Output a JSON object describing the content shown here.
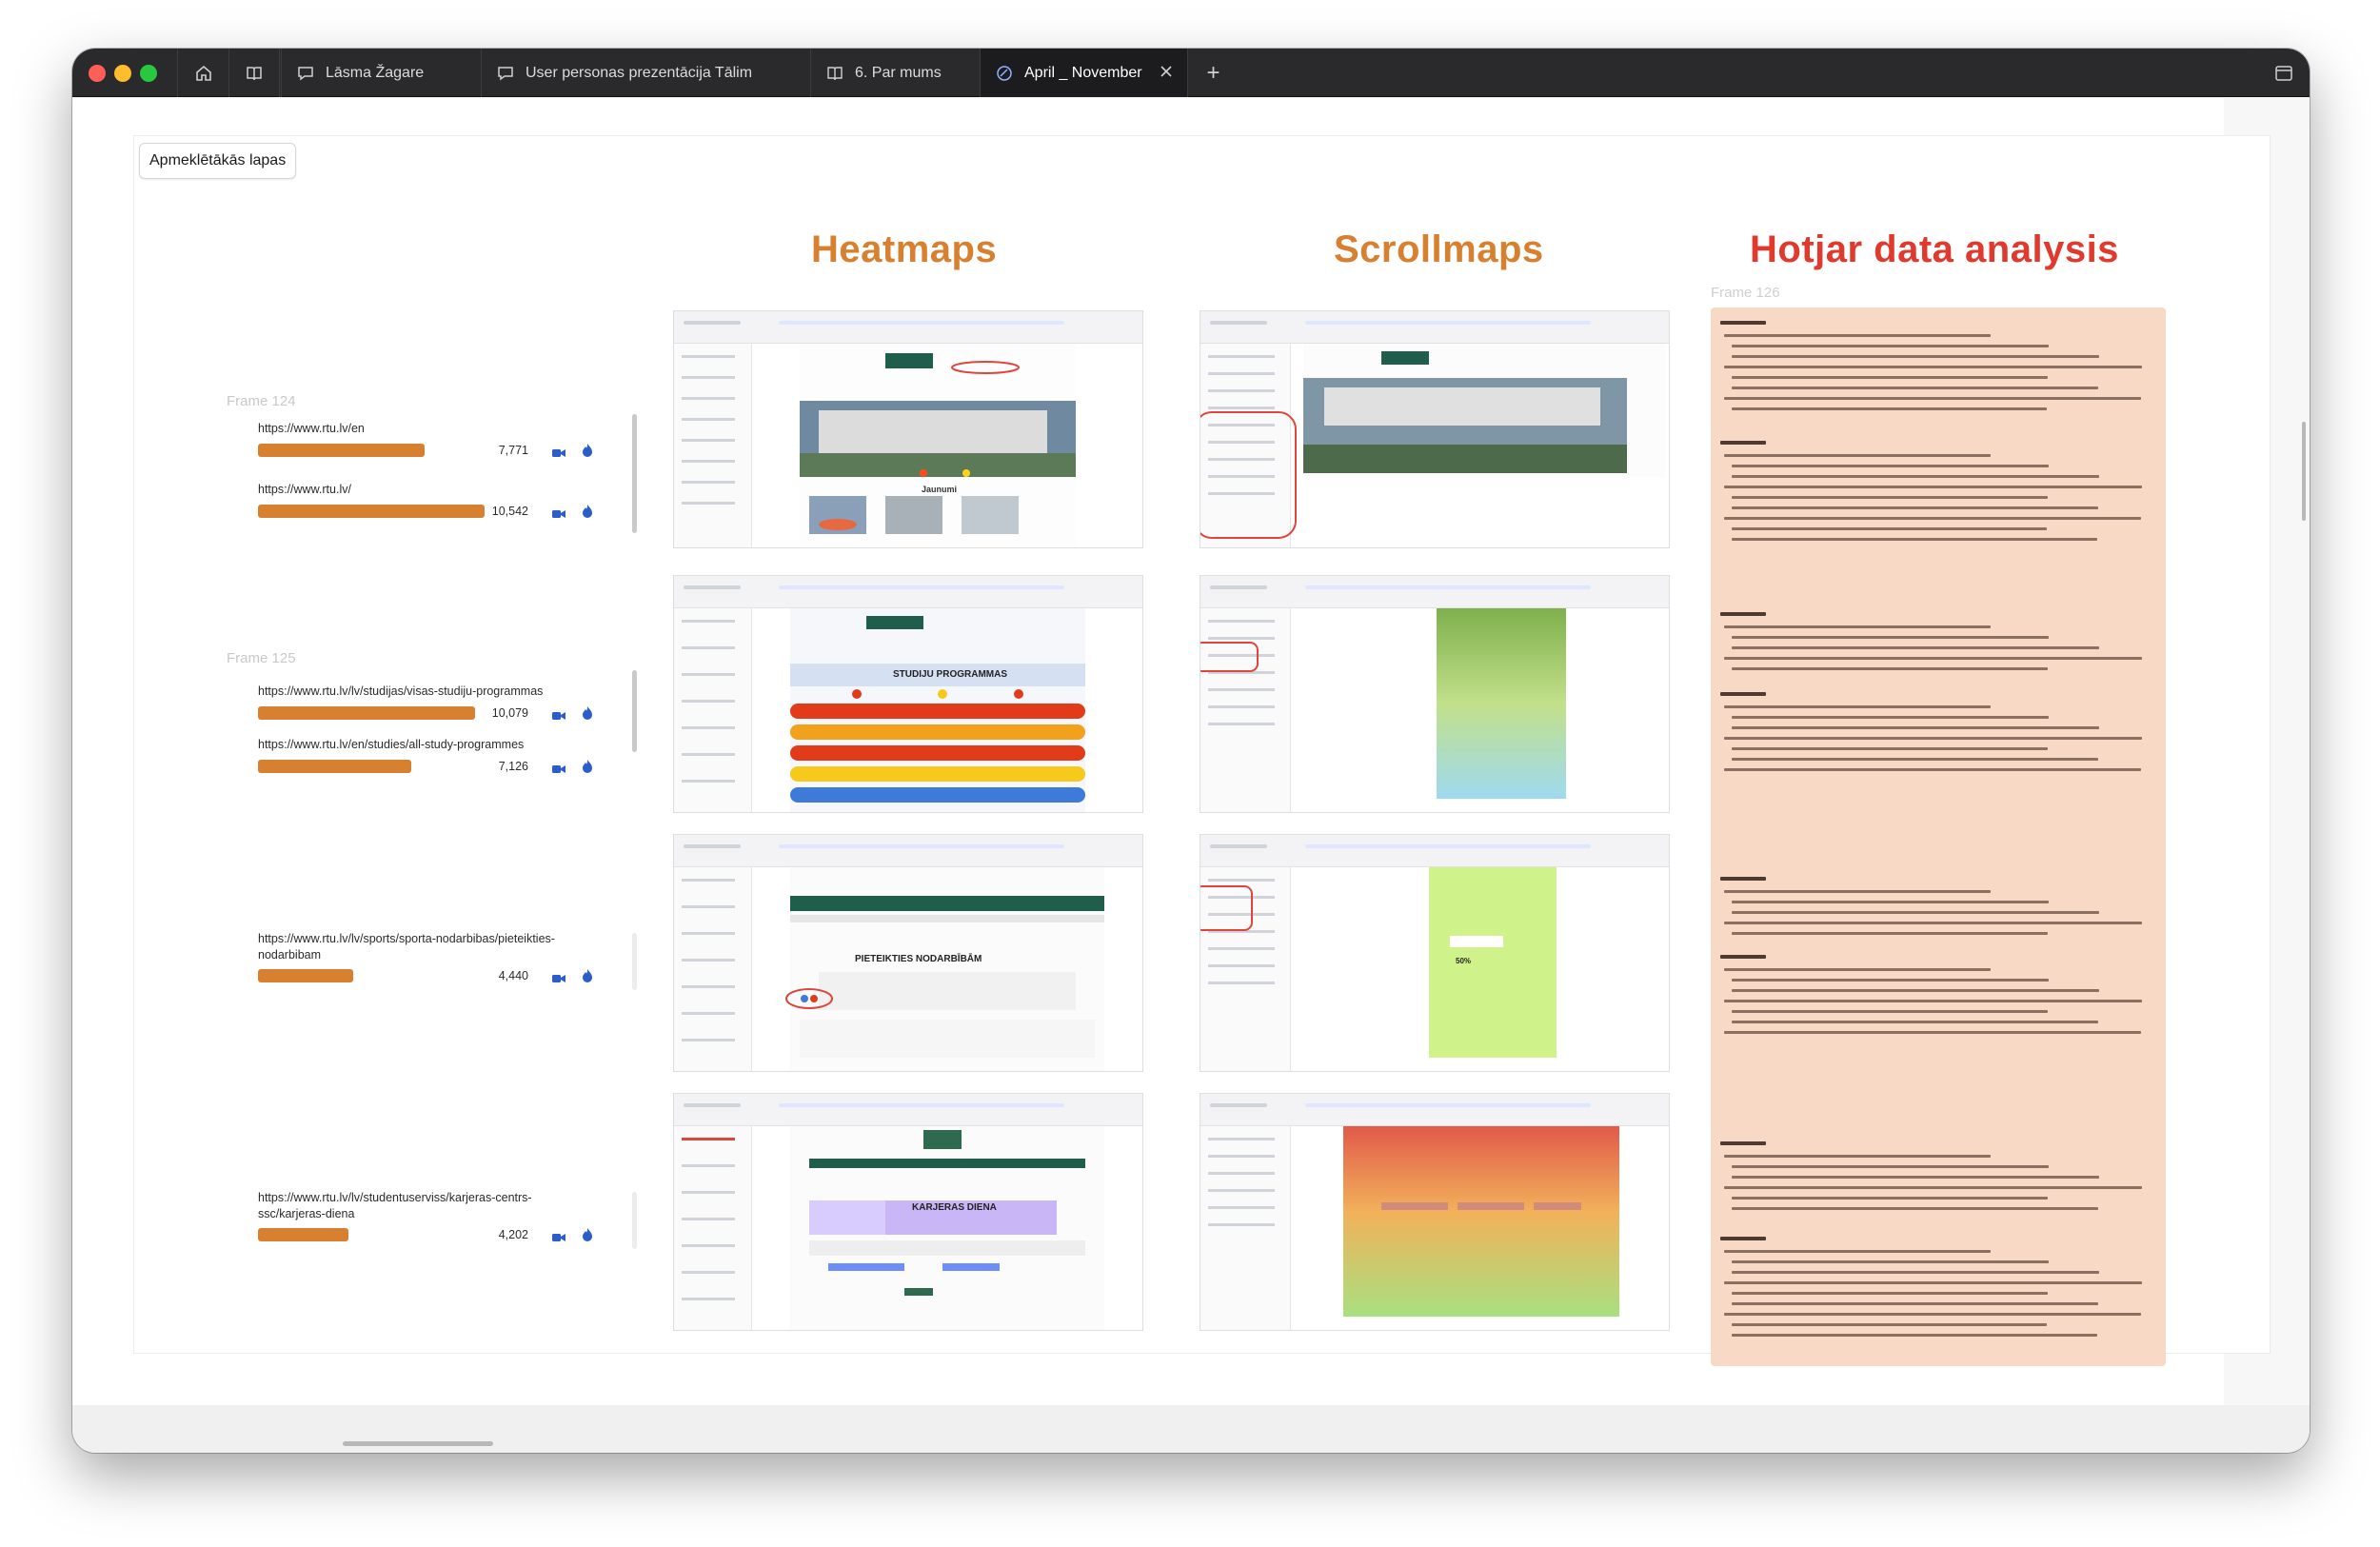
{
  "browser": {
    "tabs": [
      {
        "label": "Lāsma Žagare",
        "icon": "chat-icon"
      },
      {
        "label": "User personas prezentācija Tālim",
        "icon": "chat-icon"
      },
      {
        "label": "6. Par mums",
        "icon": "book-icon"
      },
      {
        "label": "April _ November",
        "icon": "design-icon",
        "active": true
      }
    ],
    "new_tab_label": "+"
  },
  "board": {
    "chip_label": "Apmeklētākās lapas",
    "headings": {
      "heatmaps": "Heatmaps",
      "scrollmaps": "Scrollmaps",
      "analysis": "Hotjar data analysis"
    },
    "heading_colors": {
      "heatmaps": "#d68030",
      "scrollmaps": "#d68030",
      "analysis": "#e03a2f"
    },
    "bar_color": "#d68030",
    "frames": [
      {
        "label": "Frame 124"
      },
      {
        "label": "Frame 125"
      },
      {
        "label": "Frame 126"
      }
    ],
    "pages": [
      {
        "url": "https://www.rtu.lv/en",
        "visits": "7,771",
        "visits_n": 7771
      },
      {
        "url": "https://www.rtu.lv/",
        "visits": "10,542",
        "visits_n": 10542
      },
      {
        "url": "https://www.rtu.lv/lv/studijas/visas-studiju-programmas",
        "visits": "10,079",
        "visits_n": 10079
      },
      {
        "url": "https://www.rtu.lv/en/studies/all-study-programmes",
        "visits": "7,126",
        "visits_n": 7126
      },
      {
        "url": "https://www.rtu.lv/lv/sports/sporta-nodarbibas/pieteikties-nodarbibam",
        "visits": "4,440",
        "visits_n": 4440
      },
      {
        "url": "https://www.rtu.lv/lv/studentuserviss/karjeras-centrs-ssc/karjeras-diena",
        "visits": "4,202",
        "visits_n": 4202
      }
    ],
    "thumbs": {
      "heat_titles": [
        "Jaunumi",
        "STUDIJU PROGRAMMAS",
        "PIETEIKTIES NODARBĪBĀM",
        "KARJERAS DIENA"
      ],
      "scroll_badge": "50%"
    }
  }
}
